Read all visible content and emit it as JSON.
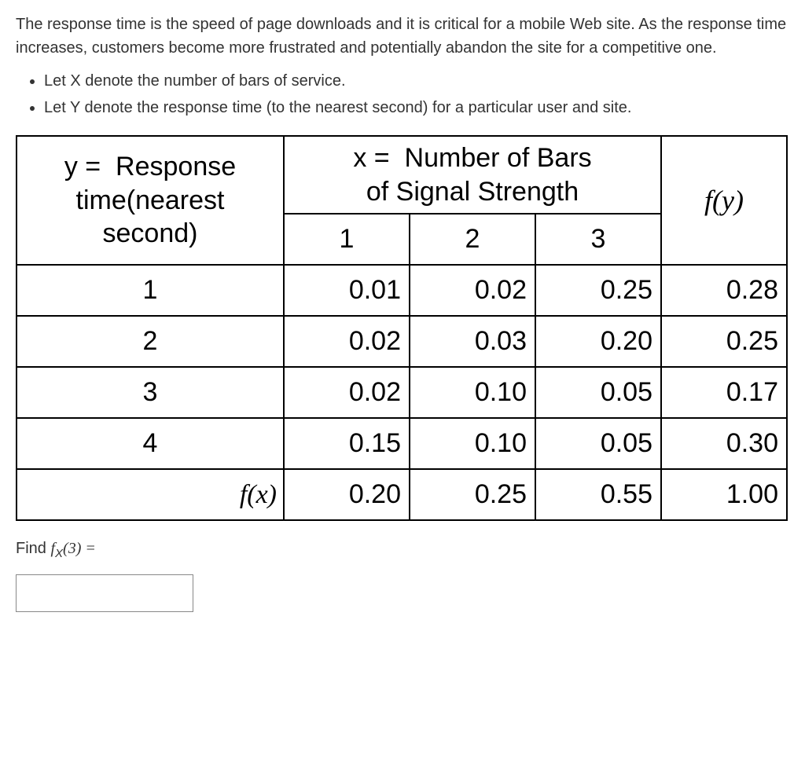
{
  "intro": "The response time is the speed of page downloads and it is critical for a mobile Web site. As the response time increases, customers become more frustrated and potentially abandon the site for a competitive one.",
  "defs": {
    "x": "Let X denote the number of bars of service.",
    "y": "Let Y denote the response time (to the nearest second) for a particular user and site."
  },
  "table": {
    "y_header": "y =  Response time(nearest second)",
    "x_header": "x =  Number of Bars of Signal Strength",
    "fy_label": "f(y)",
    "fx_label": "f(x)",
    "x_cols": [
      "1",
      "2",
      "3"
    ],
    "rows": [
      {
        "y": "1",
        "v": [
          "0.01",
          "0.02",
          "0.25"
        ],
        "fy": "0.28"
      },
      {
        "y": "2",
        "v": [
          "0.02",
          "0.03",
          "0.20"
        ],
        "fy": "0.25"
      },
      {
        "y": "3",
        "v": [
          "0.02",
          "0.10",
          "0.05"
        ],
        "fy": "0.17"
      },
      {
        "y": "4",
        "v": [
          "0.15",
          "0.10",
          "0.05"
        ],
        "fy": "0.30"
      }
    ],
    "fx_row": {
      "v": [
        "0.20",
        "0.25",
        "0.55"
      ],
      "total": "1.00"
    }
  },
  "question": {
    "prefix": "Find ",
    "func": "f",
    "sub": "X",
    "arg": "(3) ="
  },
  "answer_value": ""
}
